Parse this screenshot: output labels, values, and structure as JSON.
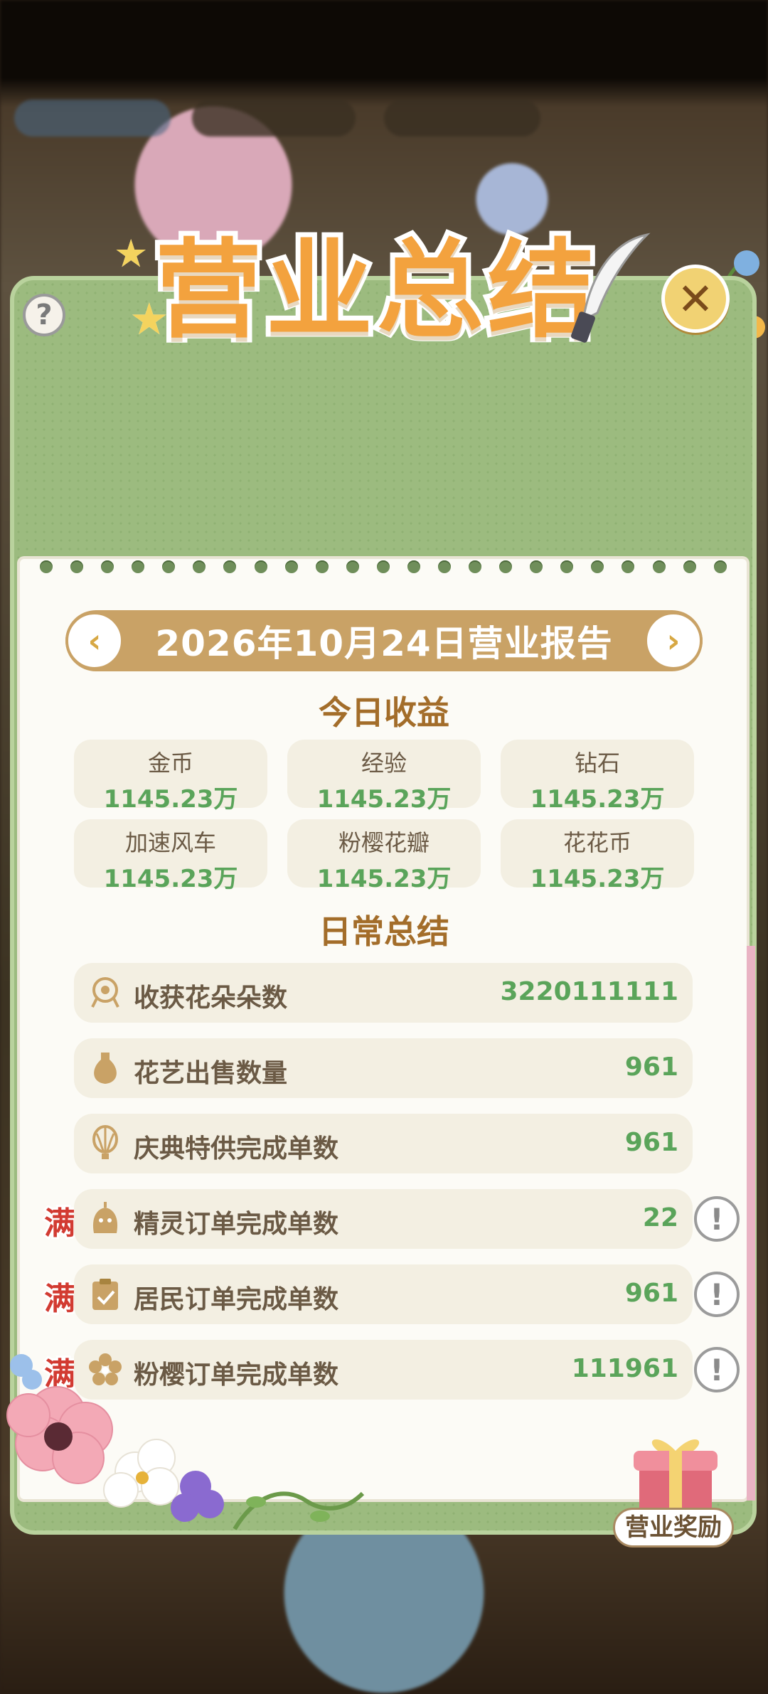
{
  "header": {
    "title": "营业总结"
  },
  "report": {
    "date_title": "2026年10月24日营业报告",
    "prev_label": "‹",
    "next_label": "›"
  },
  "today_income": {
    "title": "今日收益",
    "items": [
      {
        "label": "金币",
        "value": "1145.23万"
      },
      {
        "label": "经验",
        "value": "1145.23万"
      },
      {
        "label": "钻石",
        "value": "1145.23万"
      },
      {
        "label": "加速风车",
        "value": "1145.23万"
      },
      {
        "label": "粉樱花瓣",
        "value": "1145.23万"
      },
      {
        "label": "花花币",
        "value": "1145.23万"
      }
    ]
  },
  "daily_summary": {
    "title": "日常总结",
    "rows": [
      {
        "icon": "rose-icon",
        "label": "收获花朵朵数",
        "value": "3220111111",
        "full": ""
      },
      {
        "icon": "vase-icon",
        "label": "花艺出售数量",
        "value": "961",
        "full": ""
      },
      {
        "icon": "balloon-icon",
        "label": "庆典特供完成单数",
        "value": "961",
        "full": ""
      },
      {
        "icon": "spirit-icon",
        "label": "精灵订单完成单数",
        "value": "22",
        "full": "满"
      },
      {
        "icon": "clipboard-icon",
        "label": "居民订单完成单数",
        "value": "961",
        "full": "满"
      },
      {
        "icon": "sakura-icon",
        "label": "粉樱订单完成单数",
        "value": "111961",
        "full": "满"
      }
    ]
  },
  "icons": {
    "help": "?",
    "close": "✕",
    "info": "!"
  },
  "reward": {
    "label": "营业奖励"
  },
  "colors": {
    "accent_gold": "#c9a266",
    "value_green": "#5aa45a",
    "title_orange": "#f3a23e",
    "card_green": "#9cbb7f",
    "full_red": "#d23b32"
  }
}
